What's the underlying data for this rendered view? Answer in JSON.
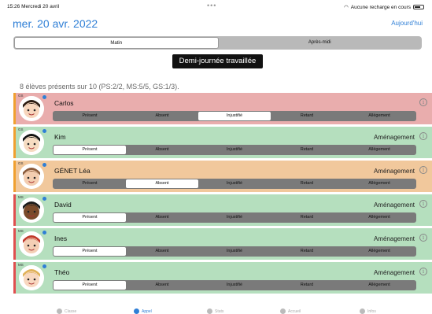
{
  "status_bar": {
    "time": "15:26",
    "day": "Mercredi 20 avril",
    "charging": "Aucune recharge en cours"
  },
  "header": {
    "date": "mer. 20 avr. 2022",
    "today_button": "Aujourd'hui"
  },
  "period_tabs": [
    {
      "label": "Matin",
      "selected": true
    },
    {
      "label": "Après-midi",
      "selected": false
    }
  ],
  "half_day_banner": "Demi-journée travaillée",
  "summary": "8 élèves présents sur 10 (PS:2/2, MS:5/5, GS:1/3).",
  "status_options": [
    "Présent",
    "Absent",
    "Injustifié",
    "Retard",
    "Allègement"
  ],
  "students": [
    {
      "grade": "GS",
      "name": "Carlos",
      "tag": "",
      "status": "Injustifié",
      "row_color": "#e9adad",
      "bar_color": "#f0a030"
    },
    {
      "grade": "GS",
      "name": "Kim",
      "tag": "Aménagement",
      "status": "Présent",
      "row_color": "#b5dfbe",
      "bar_color": "#f0a030"
    },
    {
      "grade": "GS",
      "name": "GÉNET Léa",
      "tag": "Aménagement",
      "status": "Absent",
      "row_color": "#f1c89c",
      "bar_color": "#f0a030"
    },
    {
      "grade": "MS",
      "name": "David",
      "tag": "Aménagement",
      "status": "Présent",
      "row_color": "#b5dfbe",
      "bar_color": "#e04f4f"
    },
    {
      "grade": "MS",
      "name": "Ines",
      "tag": "Aménagement",
      "status": "Présent",
      "row_color": "#b5dfbe",
      "bar_color": "#e04f4f"
    },
    {
      "grade": "MS",
      "name": "Théo",
      "tag": "Aménagement",
      "status": "Présent",
      "row_color": "#b5dfbe",
      "bar_color": "#e04f4f"
    }
  ],
  "tabs": [
    {
      "label": "Classe",
      "active": false,
      "icon": "class-icon"
    },
    {
      "label": "Appel",
      "active": true,
      "icon": "roll-call-icon"
    },
    {
      "label": "Stats",
      "active": false,
      "icon": "stats-icon"
    },
    {
      "label": "Accueil",
      "active": false,
      "icon": "home-icon"
    },
    {
      "label": "Infos",
      "active": false,
      "icon": "info-icon"
    }
  ]
}
